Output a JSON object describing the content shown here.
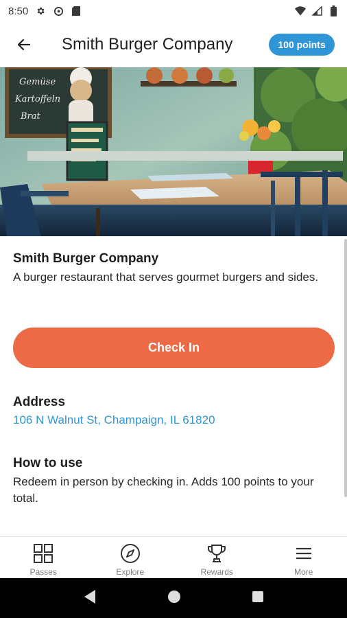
{
  "status_bar": {
    "time": "8:50",
    "icons_left": [
      "gear-icon",
      "data-saver-icon",
      "sd-card-icon"
    ],
    "icons_right": [
      "wifi-icon",
      "cell-signal-icon",
      "battery-icon"
    ]
  },
  "app_bar": {
    "back_icon": "arrow-left-icon",
    "title": "Smith Burger Company",
    "points_badge": "100 points"
  },
  "hero_image": {
    "subject": "outdoor cafe terrace with wooden table and chairs, chalkboard, flowers"
  },
  "business": {
    "name": "Smith Burger Company",
    "description": "A burger restaurant that serves gourmet burgers and sides."
  },
  "check_in": {
    "label": "Check In"
  },
  "address_section": {
    "title": "Address",
    "value": "106 N Walnut St, Champaign, IL 61820"
  },
  "howto_section": {
    "title": "How to use",
    "text": "Redeem in person by checking in. Adds 100 points to your total."
  },
  "bottom_nav": {
    "items": [
      {
        "label": "Passes",
        "icon": "grid-icon"
      },
      {
        "label": "Explore",
        "icon": "compass-icon"
      },
      {
        "label": "Rewards",
        "icon": "trophy-icon"
      },
      {
        "label": "More",
        "icon": "menu-icon"
      }
    ]
  },
  "system_nav": {
    "icons": [
      "back-triangle-icon",
      "home-circle-icon",
      "recents-square-icon"
    ]
  },
  "colors": {
    "accent_blue": "#2f95d6",
    "checkin_orange": "#ec6a45",
    "text_dark": "#1e1e1e",
    "nav_label_gray": "#7a7a7a"
  }
}
